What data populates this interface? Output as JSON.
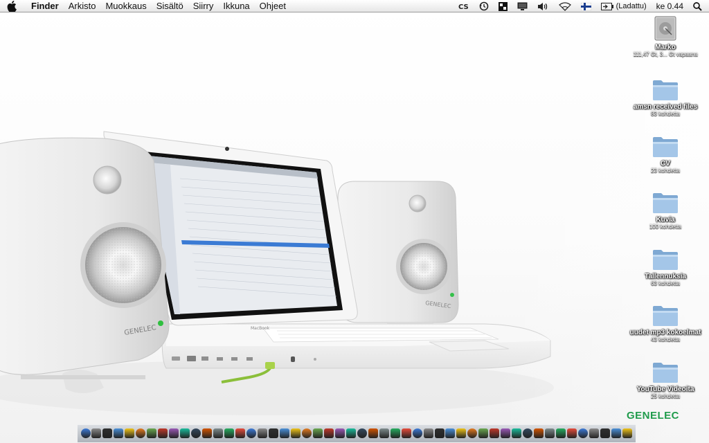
{
  "menubar": {
    "items": [
      "Finder",
      "Arkisto",
      "Muokkaus",
      "Sisältö",
      "Siirry",
      "Ikkuna",
      "Ohjeet"
    ],
    "battery_label": "(Ladattu)",
    "clock": "ke 0.44"
  },
  "desktop_icons": [
    {
      "label": "Marko",
      "sub": "111,47 Gt, 3... Gt vapaana",
      "icon": "hard-drive-icon"
    },
    {
      "label": "amsn received files",
      "sub": "83 kohdetta",
      "icon": "folder-icon"
    },
    {
      "label": "CV",
      "sub": "23 kohdetta",
      "icon": "folder-icon"
    },
    {
      "label": "Kuvia",
      "sub": "100 kohdetta",
      "icon": "folder-icon"
    },
    {
      "label": "Tallennuksia",
      "sub": "63 kohdetta",
      "icon": "folder-icon"
    },
    {
      "label": "uudet mp3 kokoelmat",
      "sub": "43 kohdetta",
      "icon": "folder-icon"
    },
    {
      "label": "YouTube Videoita",
      "sub": "25 kohdetta",
      "icon": "folder-icon"
    }
  ],
  "wallpaper": {
    "brand": "GENELEC",
    "brand_color": "#1f9b4b",
    "speaker_label": "GENELEC",
    "laptop_label": "MacBook"
  },
  "dock": {
    "item_count": 50
  }
}
